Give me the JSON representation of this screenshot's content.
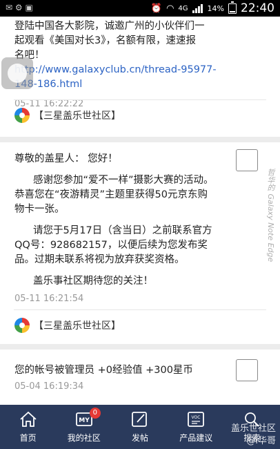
{
  "status_bar": {
    "network": "4G",
    "battery": "14%",
    "time": "22:40"
  },
  "message1": {
    "lines": [
      "登陆中国各大影院，诚邀广州的小伙伴们一",
      "起观看《美国对长3》，名额有限，速速报",
      "名吧！"
    ],
    "link_lines": [
      "http://www.galaxyclub.cn/thread-95977-",
      "148-186.html"
    ],
    "timestamp": "05-11 16:22:22",
    "source": "【三星盖乐世社区】"
  },
  "message2": {
    "greeting": "尊敬的盖星人：  您好！",
    "para1": [
      "感谢您参加“爱不一样”摄影大赛的活动。",
      "恭喜您在“夜游精灵”主题里获得50元京东购",
      "物卡一张。"
    ],
    "para2": [
      "请您于5月17日（含当日）之前联系官方",
      "QQ号：928682157，以便后续为您发布奖",
      "品。过期未联系将视为放弃获奖资格。"
    ],
    "para3": "盖乐事社区期待您的关注！",
    "timestamp": "05-11 16:21:54",
    "source": "【三星盖乐世社区】"
  },
  "message3": {
    "text": "您的帐号被管理员 +0经验值 +300星币",
    "timestamp": "05-04 16:19:34"
  },
  "watermark": {
    "vertical": "哲华的 Galaxy Note Edge",
    "bottom_line1": "盖乐世社区",
    "bottom_line2": "@i华哥"
  },
  "bottom_nav": {
    "items": [
      {
        "label": "首页",
        "icon": "home-icon"
      },
      {
        "label": "我的社区",
        "icon": "my-community-icon",
        "badge": "0",
        "icon_text": "MY"
      },
      {
        "label": "发帖",
        "icon": "compose-icon"
      },
      {
        "label": "产品建议",
        "icon": "feedback-icon",
        "icon_text": "VOC"
      },
      {
        "label": "搜索",
        "icon": "search-icon"
      }
    ]
  },
  "colors": {
    "nav_bg": "#2a3a5c",
    "link": "#2c63c4",
    "badge": "#e53935"
  }
}
